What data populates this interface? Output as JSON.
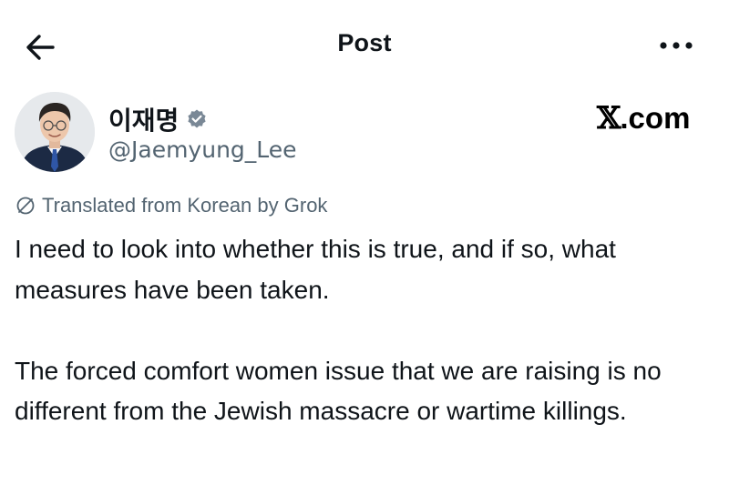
{
  "header": {
    "title": "Post",
    "back_icon": "arrow-left-icon",
    "more_icon": "more-horizontal-icon"
  },
  "author": {
    "display_name": "이재명",
    "handle": "@Jaemyung_Lee",
    "verified_icon": "verified-badge-icon",
    "verified_color": "#7a8896"
  },
  "watermark": {
    "x": "𝕏",
    "suffix": ".com"
  },
  "translation": {
    "icon": "translate-globe-icon",
    "label": "Translated from Korean by Grok"
  },
  "post": {
    "lines_paragraph_1": "I need to look into whether this is true, and if so, what measures have been taken.",
    "lines_paragraph_2": "The forced comfort women issue that we are raising is no different from the Jewish massacre or wartime killings."
  },
  "colors": {
    "text": "#0f1419",
    "secondary": "#536471",
    "background": "#ffffff"
  }
}
